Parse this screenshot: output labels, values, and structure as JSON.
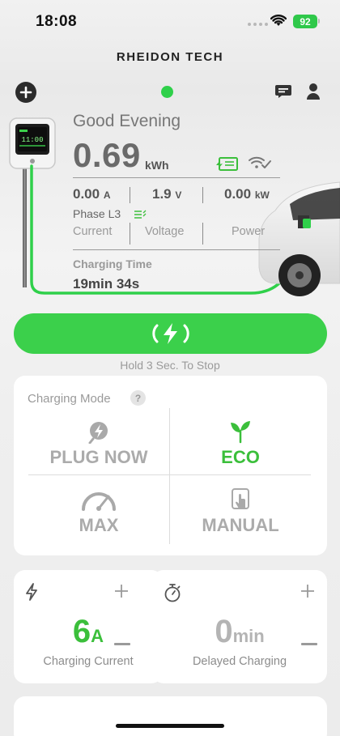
{
  "status_bar": {
    "time": "18:08",
    "battery": "92"
  },
  "app": {
    "brand": "RHEIDON TECH"
  },
  "charger": {
    "greeting": "Good Evening",
    "energy_value": "0.69",
    "energy_unit": "kWh",
    "current_value": "0.00",
    "current_unit": "A",
    "voltage_value": "1.9",
    "voltage_unit": "V",
    "power_value": "0.00",
    "power_unit": "kW",
    "phase": "Phase L3",
    "labels": {
      "current": "Current",
      "voltage": "Voltage",
      "power": "Power"
    },
    "charging_time_label": "Charging Time",
    "charging_time_value": "19min 34s",
    "display_digits": "11:00"
  },
  "action": {
    "hint": "Hold 3 Sec. To Stop"
  },
  "charging_mode": {
    "title": "Charging Mode",
    "help": "?",
    "options": [
      {
        "label": "PLUG NOW",
        "icon": "plug-bolt-icon",
        "selected": false
      },
      {
        "label": "ECO",
        "icon": "leaf-icon",
        "selected": true
      },
      {
        "label": "MAX",
        "icon": "speedometer-icon",
        "selected": false
      },
      {
        "label": "MANUAL",
        "icon": "hand-tap-icon",
        "selected": false
      }
    ]
  },
  "charging_current": {
    "value": "6",
    "unit": "A",
    "label": "Charging Current"
  },
  "delayed_charging": {
    "value": "0",
    "unit": "min",
    "label": "Delayed Charging"
  },
  "colors": {
    "accent": "#3bd04b",
    "eco_green": "#3bbf3b",
    "muted": "#ababab"
  }
}
